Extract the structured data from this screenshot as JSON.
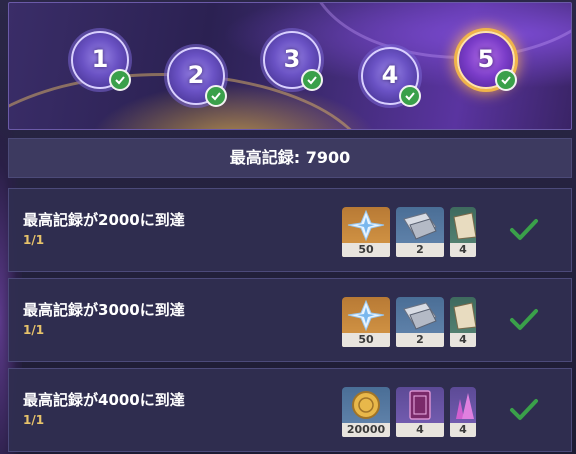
{
  "stages": [
    {
      "number": "1",
      "completed": true,
      "active": false
    },
    {
      "number": "2",
      "completed": true,
      "active": false
    },
    {
      "number": "3",
      "completed": true,
      "active": false
    },
    {
      "number": "4",
      "completed": true,
      "active": false
    },
    {
      "number": "5",
      "completed": true,
      "active": true
    }
  ],
  "best_record": {
    "text": "最高記録: 7900"
  },
  "tasks": [
    {
      "title": "最高記録が2000に到達",
      "progress": "1/1",
      "completed": true,
      "rewards": [
        {
          "icon": "primogem-icon",
          "qty": "50"
        },
        {
          "icon": "mystic-ore-icon",
          "qty": "2"
        },
        {
          "icon": "hero-wit-book-icon",
          "qty": "4"
        }
      ]
    },
    {
      "title": "最高記録が3000に到達",
      "progress": "1/1",
      "completed": true,
      "rewards": [
        {
          "icon": "primogem-icon",
          "qty": "50"
        },
        {
          "icon": "mystic-ore-icon",
          "qty": "2"
        },
        {
          "icon": "hero-wit-book-icon",
          "qty": "4"
        }
      ]
    },
    {
      "title": "最高記録が4000に到達",
      "progress": "1/1",
      "completed": true,
      "rewards": [
        {
          "icon": "mora-coin-icon",
          "qty": "20000"
        },
        {
          "icon": "talent-book-icon",
          "qty": "4"
        },
        {
          "icon": "crystal-material-icon",
          "qty": "4"
        }
      ]
    }
  ],
  "colors": {
    "progress_text": "#e8c36a",
    "check_green": "#3aa04a",
    "active_glow": "#f0b44a"
  }
}
